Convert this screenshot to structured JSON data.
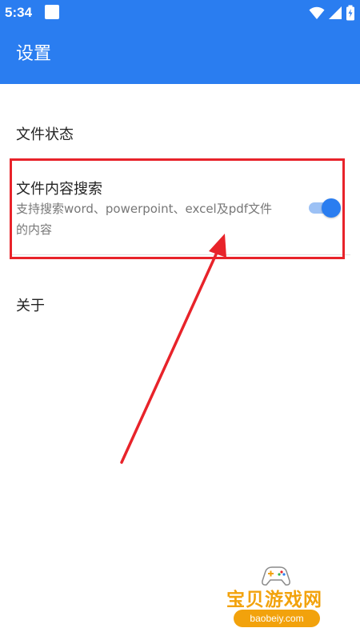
{
  "status_bar": {
    "time": "5:34",
    "icons": [
      "wifi-icon",
      "signal-icon",
      "battery-charging-icon"
    ]
  },
  "app_bar": {
    "title": "设置"
  },
  "settings": {
    "items": [
      {
        "title": "文件状态"
      },
      {
        "title": "文件内容搜索",
        "description": "支持搜索word、powerpoint、excel及pdf文件的内容",
        "toggle_on": true
      },
      {
        "title": "关于"
      }
    ]
  },
  "annotation": {
    "box_color": "#e8232a",
    "arrow_color": "#e8232a"
  },
  "watermark": {
    "title": "宝贝游戏网",
    "url": "baobeiy.com"
  },
  "colors": {
    "primary": "#2a7df0",
    "toggle_track": "#9cc1f5"
  }
}
